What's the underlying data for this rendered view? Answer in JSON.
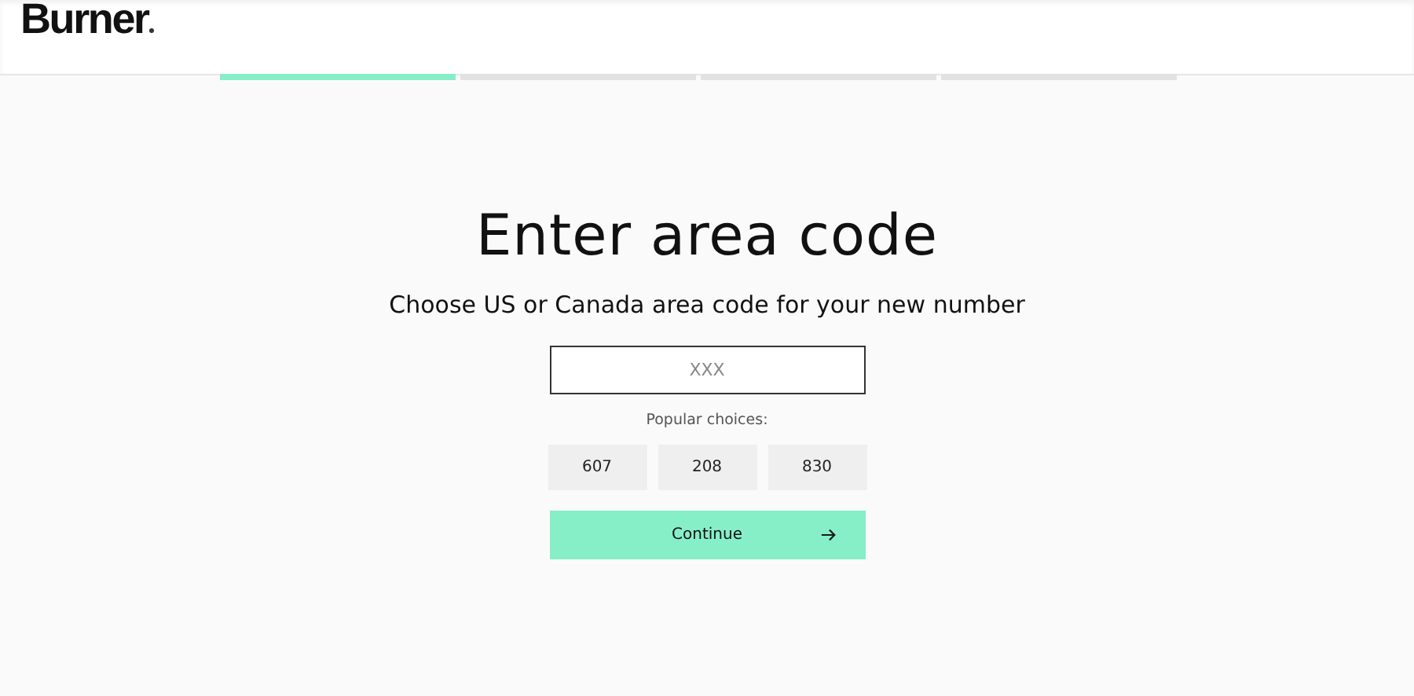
{
  "logo": "Burner",
  "progress": [
    {
      "completed": true
    },
    {
      "completed": false
    },
    {
      "completed": false
    },
    {
      "completed": false
    }
  ],
  "title": "Enter area code",
  "subtitle": "Choose US or Canada area code for your new number",
  "area_code_field": {
    "placeholder": "XXX"
  },
  "popular_label": "Popular choices:",
  "choices": [
    {
      "label": "607",
      "selected": false
    },
    {
      "label": "208",
      "selected": false
    },
    {
      "label": "830",
      "selected": false
    }
  ],
  "continue_button": {
    "label": "Continue",
    "disabled": false
  }
}
